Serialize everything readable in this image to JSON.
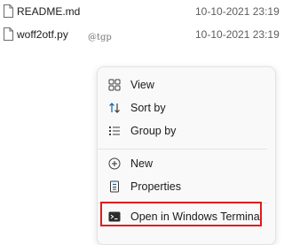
{
  "files": [
    {
      "name": "README.md",
      "modified": "10-10-2021 23:19",
      "icon": "document-icon"
    },
    {
      "name": "woff2otf.py",
      "modified": "10-10-2021 23:19",
      "icon": "document-icon"
    }
  ],
  "watermark": "@tgp",
  "context_menu": {
    "items": [
      {
        "label": "View",
        "icon": "grid-icon"
      },
      {
        "label": "Sort by",
        "icon": "sort-arrows-icon"
      },
      {
        "label": "Group by",
        "icon": "list-icon"
      },
      {
        "label": "New",
        "icon": "plus-circle-icon"
      },
      {
        "label": "Properties",
        "icon": "properties-icon"
      },
      {
        "label": "Open in Windows Terminal",
        "icon": "terminal-icon"
      }
    ],
    "highlighted_item": "Open in Windows Terminal",
    "highlight_color": "#e21b1b",
    "accent_color": "#0067c0"
  }
}
